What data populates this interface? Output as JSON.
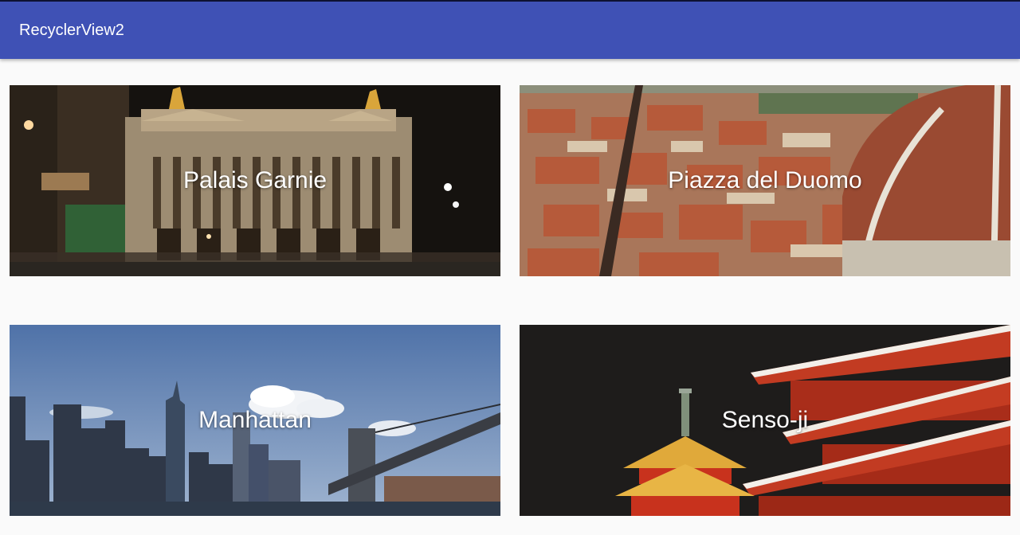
{
  "app": {
    "title": "RecyclerView2"
  },
  "cards": [
    {
      "label": "Palais Garnie"
    },
    {
      "label": "Piazza del Duomo"
    },
    {
      "label": "Manhattan"
    },
    {
      "label": "Senso-ji"
    }
  ],
  "colors": {
    "app_bar": "#3f51b5",
    "status_bar": "#0f1233",
    "background": "#fafafa",
    "label_text": "#ffffff"
  }
}
